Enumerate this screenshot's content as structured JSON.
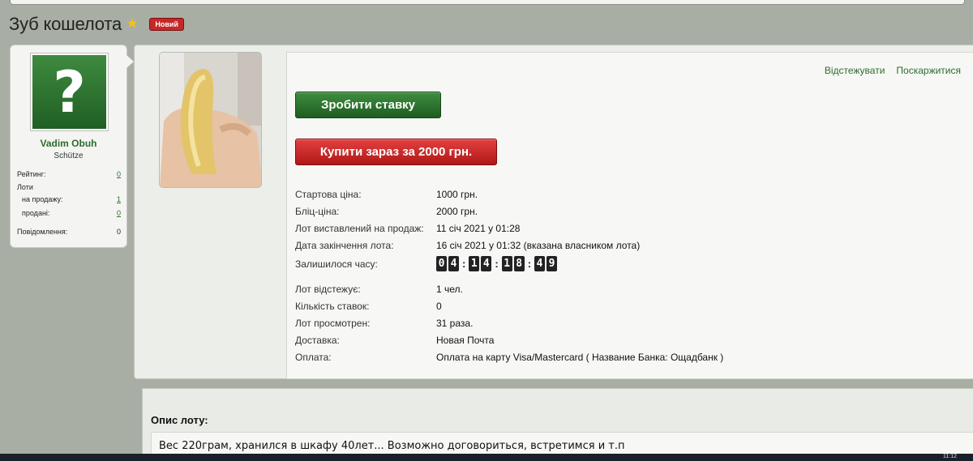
{
  "page": {
    "title": "Зуб кошелота",
    "badge": "Новий"
  },
  "seller": {
    "avatar_glyph": "?",
    "name": "Vadim Obuh",
    "rank": "Schütze",
    "stats": [
      {
        "label": "Рейтинг:",
        "value": "0"
      },
      {
        "label": "Лоти",
        "value": ""
      },
      {
        "label": "на продажу:",
        "value": "1"
      },
      {
        "label": "продані:",
        "value": "0"
      },
      {
        "label": "Повідомлення:",
        "value": "0"
      }
    ]
  },
  "lot": {
    "links": {
      "watch": "Відстежувати",
      "report": "Поскаржитися"
    },
    "bid_button": "Зробити ставку",
    "buy_button": "Купити зараз за 2000 грн.",
    "info": [
      {
        "label": "Стартова ціна:",
        "value": "1000 грн."
      },
      {
        "label": "Бліц-ціна:",
        "value": "2000 грн."
      },
      {
        "label": "Лот виставлений на продаж:",
        "value": "11 січ 2021 у 01:28"
      },
      {
        "label": "Дата закінчення лота:",
        "value": "16 січ 2021 у 01:32 (вказана власником лота)"
      }
    ],
    "time_left_label": "Залишилося часу:",
    "time_left": [
      "0",
      "4",
      "1",
      "4",
      "1",
      "8",
      "4",
      "9"
    ],
    "info2": [
      {
        "label": "Лот відстежує:",
        "value": "1 чел."
      },
      {
        "label": "Кількість ставок:",
        "value": "0"
      },
      {
        "label": "Лот просмотрен:",
        "value": "31 раза."
      },
      {
        "label": "Доставка:",
        "value": "Новая Почта"
      },
      {
        "label": "Оплата:",
        "value": "Оплата на карту Visa/Mastercard ( Название Банка: Ощадбанк )"
      }
    ]
  },
  "description": {
    "title": "Опис лоту:",
    "text": "Вес 220грам, хранился в шкафу 40лет... Возможно договориться, встретимся и т.п"
  },
  "taskbar": {
    "clock": "11:12"
  },
  "colors": {
    "accent_green": "#2e6b2e",
    "buy_red": "#c62828",
    "star": "#f0c419"
  }
}
